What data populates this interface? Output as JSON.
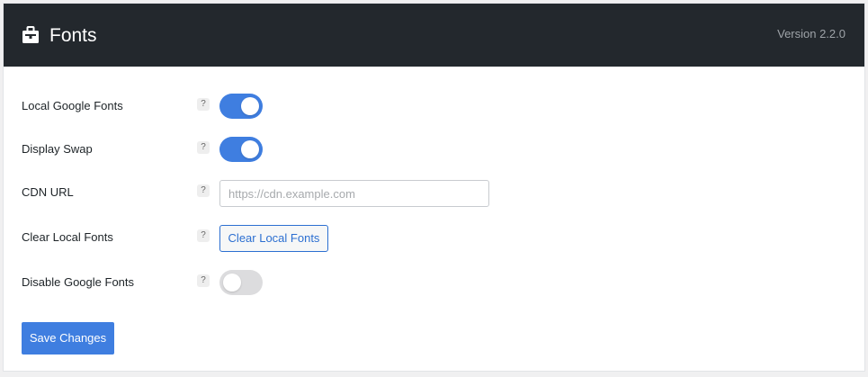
{
  "header": {
    "icon": "briefcase-icon",
    "title": "Fonts",
    "version": "Version 2.2.0"
  },
  "settings": [
    {
      "label": "Local Google Fonts",
      "help": "?",
      "control": "toggle",
      "enabled": true
    },
    {
      "label": "Display Swap",
      "help": "?",
      "control": "toggle",
      "enabled": true
    },
    {
      "label": "CDN URL",
      "help": "?",
      "control": "text-input",
      "value": "",
      "placeholder": "https://cdn.example.com"
    },
    {
      "label": "Clear Local Fonts",
      "help": "?",
      "control": "button",
      "button_label": "Clear Local Fonts"
    },
    {
      "label": "Disable Google Fonts",
      "help": "?",
      "control": "toggle",
      "enabled": false
    }
  ],
  "actions": {
    "save_label": "Save Changes"
  },
  "colors": {
    "header_background": "#23282d",
    "accent": "#3f7ee0",
    "toggle_off": "#dcdcde"
  }
}
